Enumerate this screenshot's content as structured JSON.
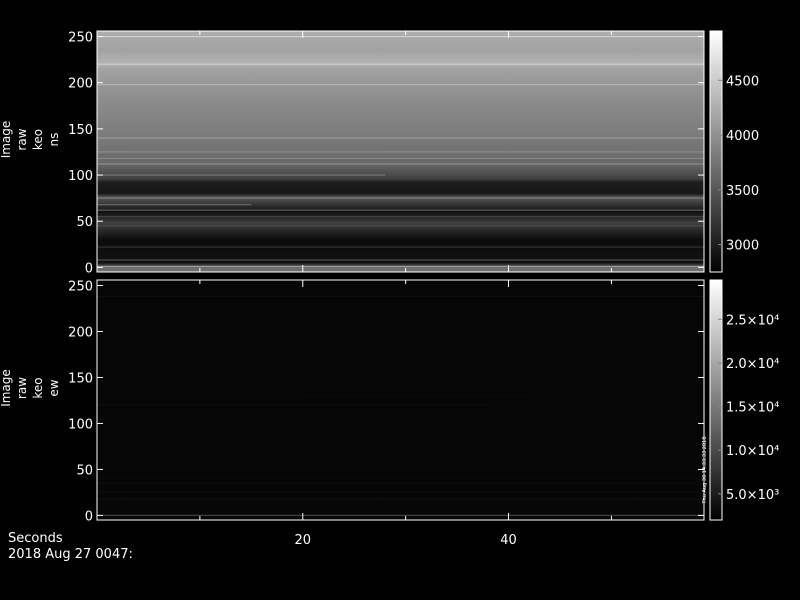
{
  "chart_data": [
    {
      "type": "heatmap",
      "title": "",
      "ylabel_lines": [
        "Image",
        "raw",
        "keo",
        "ns"
      ],
      "xlim": [
        0,
        59
      ],
      "ylim": [
        -5,
        256
      ],
      "y_ticks": [
        0,
        50,
        100,
        150,
        200,
        250
      ],
      "colorbar": {
        "range": [
          2750,
          4950
        ],
        "ticks": [
          3000,
          3500,
          4000,
          4500
        ],
        "tick_labels": [
          "3000",
          "3500",
          "4000",
          "4500"
        ]
      },
      "row_levels": [
        {
          "y": 0,
          "value": 3700
        },
        {
          "y": 5,
          "value": 2900
        },
        {
          "y": 30,
          "value": 2850
        },
        {
          "y": 48,
          "value": 3300
        },
        {
          "y": 60,
          "value": 2900
        },
        {
          "y": 76,
          "value": 3500
        },
        {
          "y": 80,
          "value": 2950
        },
        {
          "y": 92,
          "value": 3000
        },
        {
          "y": 96,
          "value": 3300
        },
        {
          "y": 112,
          "value": 3650
        },
        {
          "y": 140,
          "value": 3800
        },
        {
          "y": 180,
          "value": 3950
        },
        {
          "y": 215,
          "value": 4150
        },
        {
          "y": 220,
          "value": 4300
        },
        {
          "y": 235,
          "value": 4150
        },
        {
          "y": 256,
          "value": 4250
        }
      ],
      "row_lines": [
        {
          "y": 1,
          "value": 4100
        },
        {
          "y": 8,
          "value": 3400
        },
        {
          "y": 22,
          "value": 3200
        },
        {
          "y": 45,
          "value": 3400
        },
        {
          "y": 55,
          "value": 3300
        },
        {
          "y": 62,
          "value": 3500
        },
        {
          "y": 68,
          "value": 3600,
          "x_end": 15
        },
        {
          "y": 75,
          "value": 3800
        },
        {
          "y": 100,
          "value": 3800,
          "x_end": 28
        },
        {
          "y": 112,
          "value": 3950
        },
        {
          "y": 118,
          "value": 3900
        },
        {
          "y": 125,
          "value": 4000
        },
        {
          "y": 140,
          "value": 4050
        },
        {
          "y": 198,
          "value": 4300
        },
        {
          "y": 220,
          "value": 4500
        },
        {
          "y": 250,
          "value": 4550
        }
      ]
    },
    {
      "type": "heatmap",
      "title": "",
      "ylabel_lines": [
        "Image",
        "raw",
        "keo",
        "ew"
      ],
      "xlim": [
        0,
        59
      ],
      "ylim": [
        -5,
        256
      ],
      "y_ticks": [
        0,
        50,
        100,
        150,
        200,
        250
      ],
      "colorbar": {
        "range": [
          2000,
          29500
        ],
        "ticks": [
          5000,
          10000,
          15000,
          20000,
          25000
        ],
        "tick_labels": [
          "5.0×10³",
          "1.0×10⁴",
          "1.5×10⁴",
          "2.0×10⁴",
          "2.5×10⁴"
        ]
      },
      "row_levels": [
        {
          "y": 0,
          "value": 2800
        },
        {
          "y": 40,
          "value": 2700
        },
        {
          "y": 256,
          "value": 2650
        }
      ],
      "row_lines": [
        {
          "y": 0,
          "value": 9000
        },
        {
          "y": 18,
          "value": 3600
        },
        {
          "y": 25,
          "value": 3400
        },
        {
          "y": 35,
          "value": 3300
        },
        {
          "y": 40,
          "value": 3200
        },
        {
          "y": 120,
          "value": 3300,
          "x_end": 38
        },
        {
          "y": 130,
          "value": 3100,
          "x_start": 20,
          "x_end": 42
        },
        {
          "y": 196,
          "value": 3000,
          "x_start": 53
        },
        {
          "y": 238,
          "value": 3500
        }
      ]
    }
  ],
  "x_axis": {
    "ticks": [
      20,
      40
    ],
    "label": "Seconds",
    "date_text": "2018 Aug 27 0047:"
  },
  "side_stamp": "Thu Aug 30 14:33:33 2018"
}
